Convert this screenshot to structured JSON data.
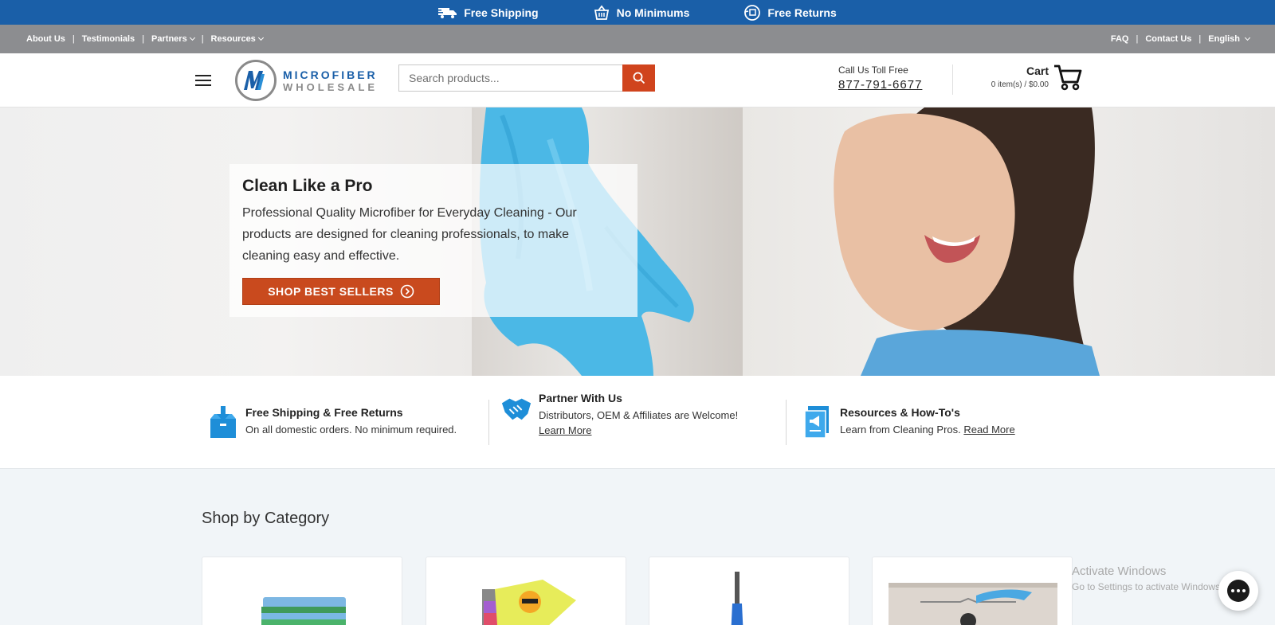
{
  "promo": {
    "shipping": "Free Shipping",
    "minimums": "No Minimums",
    "returns": "Free Returns"
  },
  "util_nav": {
    "about": "About Us",
    "testimonials": "Testimonials",
    "partners": "Partners",
    "resources": "Resources",
    "faq": "FAQ",
    "contact": "Contact Us",
    "language": "English"
  },
  "header": {
    "logo_line1": "MICROFIBER",
    "logo_line2": "WHOLESALE",
    "search_placeholder": "Search products...",
    "phone_label": "Call Us Toll Free",
    "phone_number": "877-791-6677",
    "cart_title": "Cart",
    "cart_summary": "0 item(s) / $0.00"
  },
  "hero": {
    "title": "Clean Like a Pro",
    "text": "Professional Quality Microfiber for Everyday Cleaning - Our products are designed for cleaning professionals, to make cleaning easy and effective.",
    "button": "SHOP BEST SELLERS"
  },
  "features": [
    {
      "title": "Free Shipping & Free Returns",
      "desc": "On all domestic orders. No minimum required.",
      "link": ""
    },
    {
      "title": "Partner With Us",
      "desc": "Distributors, OEM & Affiliates are Welcome!",
      "link": "Learn More"
    },
    {
      "title": "Resources & How-To's",
      "desc": "Learn from Cleaning Pros.",
      "link": "Read More"
    }
  ],
  "category": {
    "heading": "Shop by Category"
  },
  "windows_watermark": {
    "line1": "Activate Windows",
    "line2": "Go to Settings to activate Windows."
  },
  "colors": {
    "brand_blue": "#1a5fa8",
    "accent_orange": "#d0441d",
    "util_gray": "#8c8d90"
  }
}
